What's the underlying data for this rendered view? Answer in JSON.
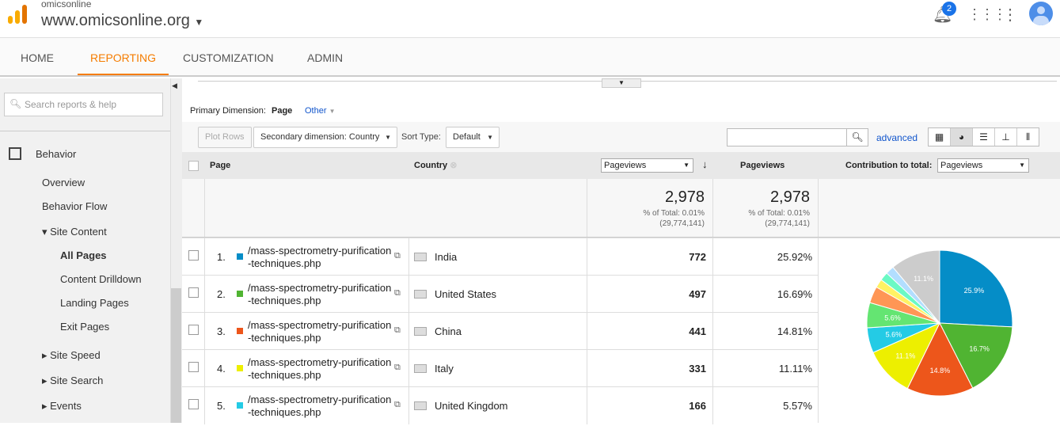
{
  "header": {
    "account": "omicsonline",
    "property": "www.omicsonline.org",
    "notification_count": "2"
  },
  "nav": {
    "tabs": [
      "HOME",
      "REPORTING",
      "CUSTOMIZATION",
      "ADMIN"
    ],
    "active": "REPORTING"
  },
  "sidebar": {
    "search_placeholder": "Search reports & help",
    "section": "Behavior",
    "items": [
      {
        "label": "Overview",
        "level": 1
      },
      {
        "label": "Behavior Flow",
        "level": 1
      },
      {
        "label": "▾ Site Content",
        "level": 1
      },
      {
        "label": "All Pages",
        "level": 2,
        "active": true
      },
      {
        "label": "Content Drilldown",
        "level": 2
      },
      {
        "label": "Landing Pages",
        "level": 2
      },
      {
        "label": "Exit Pages",
        "level": 2
      },
      {
        "label": "▸ Site Speed",
        "level": 1
      },
      {
        "label": "▸ Site Search",
        "level": 1
      },
      {
        "label": "▸ Events",
        "level": 1
      }
    ]
  },
  "dimension": {
    "label": "Primary Dimension:",
    "primary": "Page",
    "other": "Other"
  },
  "toolbar": {
    "plot_rows": "Plot Rows",
    "secondary": "Secondary dimension: Country",
    "sort_type_label": "Sort Type:",
    "sort_type": "Default",
    "advanced": "advanced"
  },
  "table": {
    "headers": {
      "page": "Page",
      "country": "Country",
      "metric_select": "Pageviews",
      "pageviews": "Pageviews",
      "contribution": "Contribution to total:",
      "contribution_select": "Pageviews"
    },
    "totals": {
      "value1": "2,978",
      "pct1": "% of Total: 0.01%",
      "of1": "(29,774,141)",
      "value2": "2,978",
      "pct2": "% of Total: 0.01%",
      "of2": "(29,774,141)"
    },
    "rows": [
      {
        "num": "1.",
        "page1": "/mass-spectrometry-purification",
        "page2": "-techniques.php",
        "country": "India",
        "pageviews": "772",
        "pct": "25.92%",
        "color": "#058dc7"
      },
      {
        "num": "2.",
        "page1": "/mass-spectrometry-purification",
        "page2": "-techniques.php",
        "country": "United States",
        "pageviews": "497",
        "pct": "16.69%",
        "color": "#50b432"
      },
      {
        "num": "3.",
        "page1": "/mass-spectrometry-purification",
        "page2": "-techniques.php",
        "country": "China",
        "pageviews": "441",
        "pct": "14.81%",
        "color": "#ed561b"
      },
      {
        "num": "4.",
        "page1": "/mass-spectrometry-purification",
        "page2": "-techniques.php",
        "country": "Italy",
        "pageviews": "331",
        "pct": "11.11%",
        "color": "#edef00"
      },
      {
        "num": "5.",
        "page1": "/mass-spectrometry-purification",
        "page2": "-techniques.php",
        "country": "United Kingdom",
        "pageviews": "166",
        "pct": "5.57%",
        "color": "#24cbe5"
      }
    ]
  },
  "chart_data": {
    "type": "pie",
    "values": [
      25.9,
      16.7,
      14.8,
      11.1,
      5.6,
      5.6,
      3.7,
      1.9,
      1.9,
      1.9,
      11.1
    ],
    "labels": [
      "25.9%",
      "16.7%",
      "14.8%",
      "11.1%",
      "5.6%",
      "5.6%",
      "",
      "",
      "",
      "",
      "11.1%"
    ],
    "colors": [
      "#058dc7",
      "#50b432",
      "#ed561b",
      "#edef00",
      "#24cbe5",
      "#64e572",
      "#ff9655",
      "#fff263",
      "#6af9c4",
      "#b2deff",
      "#cccccc"
    ]
  }
}
